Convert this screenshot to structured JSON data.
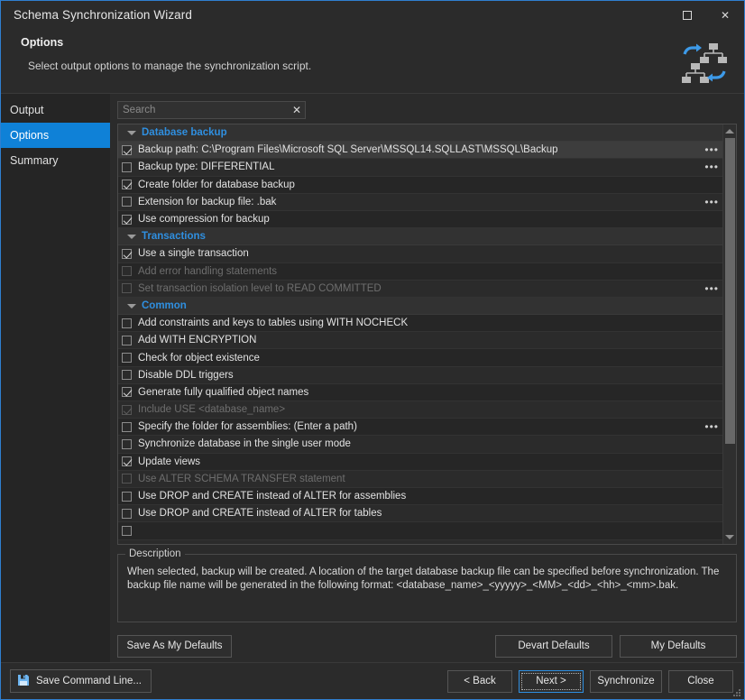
{
  "window": {
    "title": "Schema Synchronization Wizard",
    "icon": "schema-sync-icon",
    "maximize_label": "maximize-icon",
    "close_label": "✕"
  },
  "header": {
    "title": "Options",
    "subtitle": "Select output options to manage the synchronization script."
  },
  "sidebar": {
    "items": [
      {
        "label": "Output",
        "active": false
      },
      {
        "label": "Options",
        "active": true
      },
      {
        "label": "Summary",
        "active": false
      }
    ]
  },
  "search": {
    "value": "",
    "placeholder": "Search",
    "clear_label": "✕"
  },
  "options": {
    "ellipsis_label": "•••",
    "groups": [
      {
        "label": "Database backup",
        "expanded": true,
        "items": [
          {
            "label": "Backup path: C:\\Program Files\\Microsoft SQL Server\\MSSQL14.SQLLAST\\MSSQL\\Backup",
            "checked": true,
            "disabled": false,
            "ellipsis": true,
            "selected": true
          },
          {
            "label": "Backup type: DIFFERENTIAL",
            "checked": false,
            "disabled": false,
            "ellipsis": true,
            "selected": false
          },
          {
            "label": "Create folder for database backup",
            "checked": true,
            "disabled": false,
            "ellipsis": false,
            "selected": false
          },
          {
            "label": "Extension for backup file: .bak",
            "checked": false,
            "disabled": false,
            "ellipsis": true,
            "selected": false
          },
          {
            "label": "Use compression for backup",
            "checked": true,
            "disabled": false,
            "ellipsis": false,
            "selected": false
          }
        ]
      },
      {
        "label": "Transactions",
        "expanded": true,
        "items": [
          {
            "label": "Use a single transaction",
            "checked": true,
            "disabled": false,
            "ellipsis": false,
            "selected": false
          },
          {
            "label": "Add error handling statements",
            "checked": false,
            "disabled": true,
            "ellipsis": false,
            "selected": false
          },
          {
            "label": "Set transaction isolation level to READ COMMITTED",
            "checked": false,
            "disabled": true,
            "ellipsis": true,
            "selected": false
          }
        ]
      },
      {
        "label": "Common",
        "expanded": true,
        "items": [
          {
            "label": "Add constraints and keys to tables using WITH NOCHECK",
            "checked": false,
            "disabled": false,
            "ellipsis": false,
            "selected": false
          },
          {
            "label": "Add WITH ENCRYPTION",
            "checked": false,
            "disabled": false,
            "ellipsis": false,
            "selected": false
          },
          {
            "label": "Check for object existence",
            "checked": false,
            "disabled": false,
            "ellipsis": false,
            "selected": false
          },
          {
            "label": "Disable DDL triggers",
            "checked": false,
            "disabled": false,
            "ellipsis": false,
            "selected": false
          },
          {
            "label": "Generate fully qualified object names",
            "checked": true,
            "disabled": false,
            "ellipsis": false,
            "selected": false
          },
          {
            "label": "Include USE <database_name>",
            "checked": true,
            "disabled": true,
            "ellipsis": false,
            "selected": false
          },
          {
            "label": "Specify the folder for assemblies: (Enter a path)",
            "checked": false,
            "disabled": false,
            "ellipsis": true,
            "selected": false
          },
          {
            "label": "Synchronize database in the single user mode",
            "checked": false,
            "disabled": false,
            "ellipsis": false,
            "selected": false
          },
          {
            "label": "Update views",
            "checked": true,
            "disabled": false,
            "ellipsis": false,
            "selected": false
          },
          {
            "label": "Use ALTER SCHEMA TRANSFER statement",
            "checked": false,
            "disabled": true,
            "ellipsis": false,
            "selected": false
          },
          {
            "label": "Use DROP and CREATE instead of ALTER for assemblies",
            "checked": false,
            "disabled": false,
            "ellipsis": false,
            "selected": false
          },
          {
            "label": "Use DROP and CREATE instead of ALTER for tables",
            "checked": false,
            "disabled": false,
            "ellipsis": false,
            "selected": false
          },
          {
            "label": "",
            "checked": false,
            "disabled": false,
            "ellipsis": false,
            "selected": false
          }
        ]
      }
    ]
  },
  "scrollbar": {
    "up_label": "scroll-up",
    "down_label": "scroll-down",
    "thumb_top_percent": 0,
    "thumb_height_percent": 78
  },
  "description": {
    "legend": "Description",
    "text": "When selected, backup will be created. A location of the target database backup file can be specified before synchronization. The backup file name will be generated in the following format: <database_name>_<yyyyy>_<MM>_<dd>_<hh>_<mm>.bak."
  },
  "defaults_bar": {
    "save_as_my_defaults": "Save As My Defaults",
    "devart_defaults": "Devart Defaults",
    "my_defaults": "My Defaults"
  },
  "footer": {
    "save_command_line": "Save Command Line...",
    "save_icon": "floppy-save-icon",
    "back": "< Back",
    "next": "Next >",
    "synchronize": "Synchronize",
    "close": "Close"
  },
  "colors": {
    "accent": "#0f81d7",
    "group_header": "#2f8fe0",
    "window_border": "#2f7fd0",
    "background": "#2b2b2b",
    "row": "#262626",
    "selected_row": "#3d3d3d"
  }
}
